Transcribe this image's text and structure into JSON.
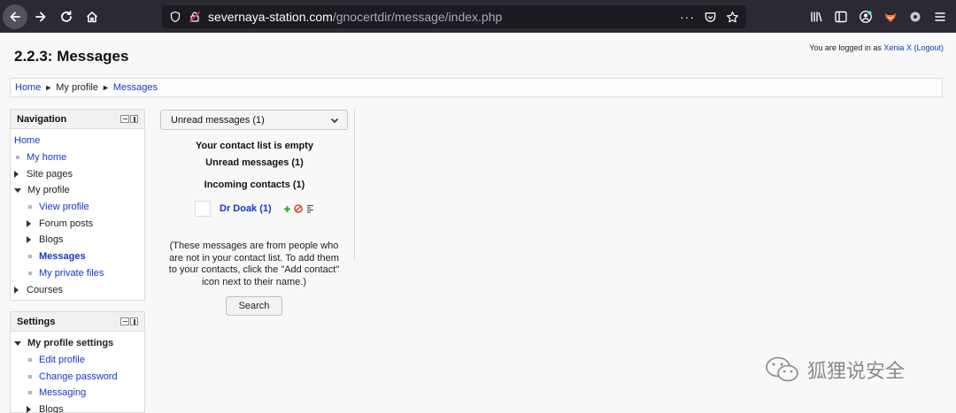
{
  "browser": {
    "url_host": "severnaya-station.com",
    "url_path": "/gnocertdir/message/index.php"
  },
  "page": {
    "title": "2.2.3: Messages",
    "login_prefix": "You are logged in as ",
    "user_name": "Xenia X",
    "logout_label": "(Logout)"
  },
  "breadcrumb": {
    "items": [
      "Home",
      "My profile",
      "Messages"
    ],
    "separator": "►"
  },
  "navigation": {
    "title": "Navigation",
    "items": [
      {
        "label": "Home",
        "level": 0,
        "type": "link"
      },
      {
        "label": "My home",
        "level": 1,
        "type": "leaf-link"
      },
      {
        "label": "Site pages",
        "level": 1,
        "type": "collapsed"
      },
      {
        "label": "My profile",
        "level": 1,
        "type": "expanded"
      },
      {
        "label": "View profile",
        "level": 2,
        "type": "leaf-link"
      },
      {
        "label": "Forum posts",
        "level": 2,
        "type": "collapsed"
      },
      {
        "label": "Blogs",
        "level": 2,
        "type": "collapsed"
      },
      {
        "label": "Messages",
        "level": 2,
        "type": "leaf-link-active"
      },
      {
        "label": "My private files",
        "level": 2,
        "type": "leaf-link"
      },
      {
        "label": "Courses",
        "level": 1,
        "type": "collapsed"
      }
    ]
  },
  "settings": {
    "title": "Settings",
    "items": [
      {
        "label": "My profile settings",
        "level": 1,
        "type": "expanded-bold"
      },
      {
        "label": "Edit profile",
        "level": 2,
        "type": "leaf-link"
      },
      {
        "label": "Change password",
        "level": 2,
        "type": "leaf-link"
      },
      {
        "label": "Messaging",
        "level": 2,
        "type": "leaf-link"
      },
      {
        "label": "Blogs",
        "level": 2,
        "type": "collapsed"
      }
    ]
  },
  "messages": {
    "select_value": "Unread messages (1)",
    "empty_contacts": "Your contact list is empty",
    "unread_heading": "Unread messages (1)",
    "incoming_heading": "Incoming contacts (1)",
    "contact_name": "Dr Doak (1)",
    "info_text": "(These messages are from people who are not in your contact list. To add them to your contacts, click the \"Add contact\" icon next to their name.)",
    "search_label": "Search"
  },
  "watermark": {
    "text": "狐狸说安全"
  },
  "colors": {
    "link": "#1538c8",
    "chrome_bg": "#2b2a33",
    "add_icon": "#3aa53a",
    "block_icon": "#d24a2a"
  }
}
